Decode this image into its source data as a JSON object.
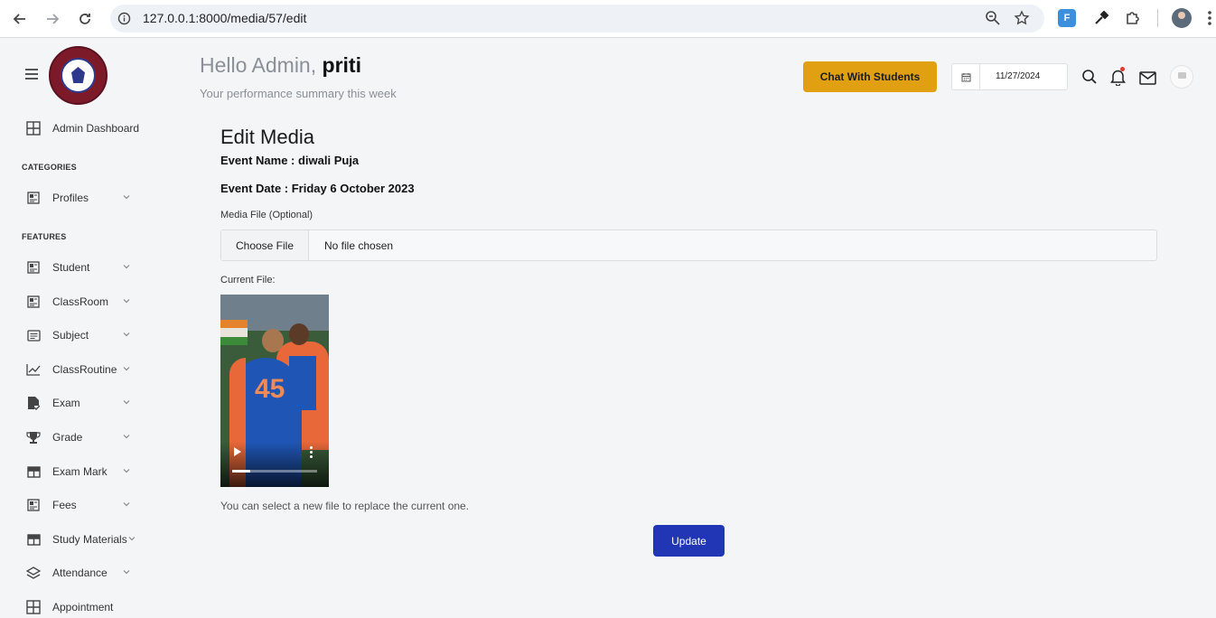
{
  "browser": {
    "url": "127.0.0.1:8000/media/57/edit",
    "extension_label": "F"
  },
  "sidebar": {
    "top_item": {
      "label": "Admin Dashboard",
      "icon": "grid-icon"
    },
    "categories_heading": "CATEGORIES",
    "categories": [
      {
        "label": "Profiles",
        "icon": "dashboard-icon"
      }
    ],
    "features_heading": "FEATURES",
    "features": [
      {
        "label": "Student",
        "icon": "dashboard-icon"
      },
      {
        "label": "ClassRoom",
        "icon": "dashboard-icon"
      },
      {
        "label": "Subject",
        "icon": "list-icon"
      },
      {
        "label": "ClassRoutine",
        "icon": "chart-icon"
      },
      {
        "label": "Exam",
        "icon": "document-check-icon"
      },
      {
        "label": "Grade",
        "icon": "trophy-icon"
      },
      {
        "label": "Exam Mark",
        "icon": "table-icon"
      },
      {
        "label": "Fees",
        "icon": "dashboard-icon"
      },
      {
        "label": "Study Materials",
        "icon": "table-icon"
      },
      {
        "label": "Attendance",
        "icon": "layers-icon"
      },
      {
        "label": "Appointment",
        "icon": "grid-icon"
      }
    ]
  },
  "header": {
    "greeting_prefix": "Hello Admin,",
    "greeting_name": "priti",
    "subtitle": "Your performance summary this week",
    "chat_button": "Chat With Students",
    "date_value": "11/27/2024"
  },
  "main": {
    "title": "Edit Media",
    "event_name": "Event Name : diwali Puja",
    "event_date": "Event Date : Friday 6 October 2023",
    "media_file_label": "Media File (Optional)",
    "choose_file_label": "Choose File",
    "no_file_text": "No file chosen",
    "current_file_label": "Current File:",
    "video_jersey_number": "45",
    "video_progress_fraction": 0.21,
    "hint": "You can select a new file to replace the current one.",
    "update_button": "Update"
  },
  "colors": {
    "accent_yellow": "#e0a012",
    "primary_blue": "#2136b5",
    "notification_dot": "#e53935"
  }
}
